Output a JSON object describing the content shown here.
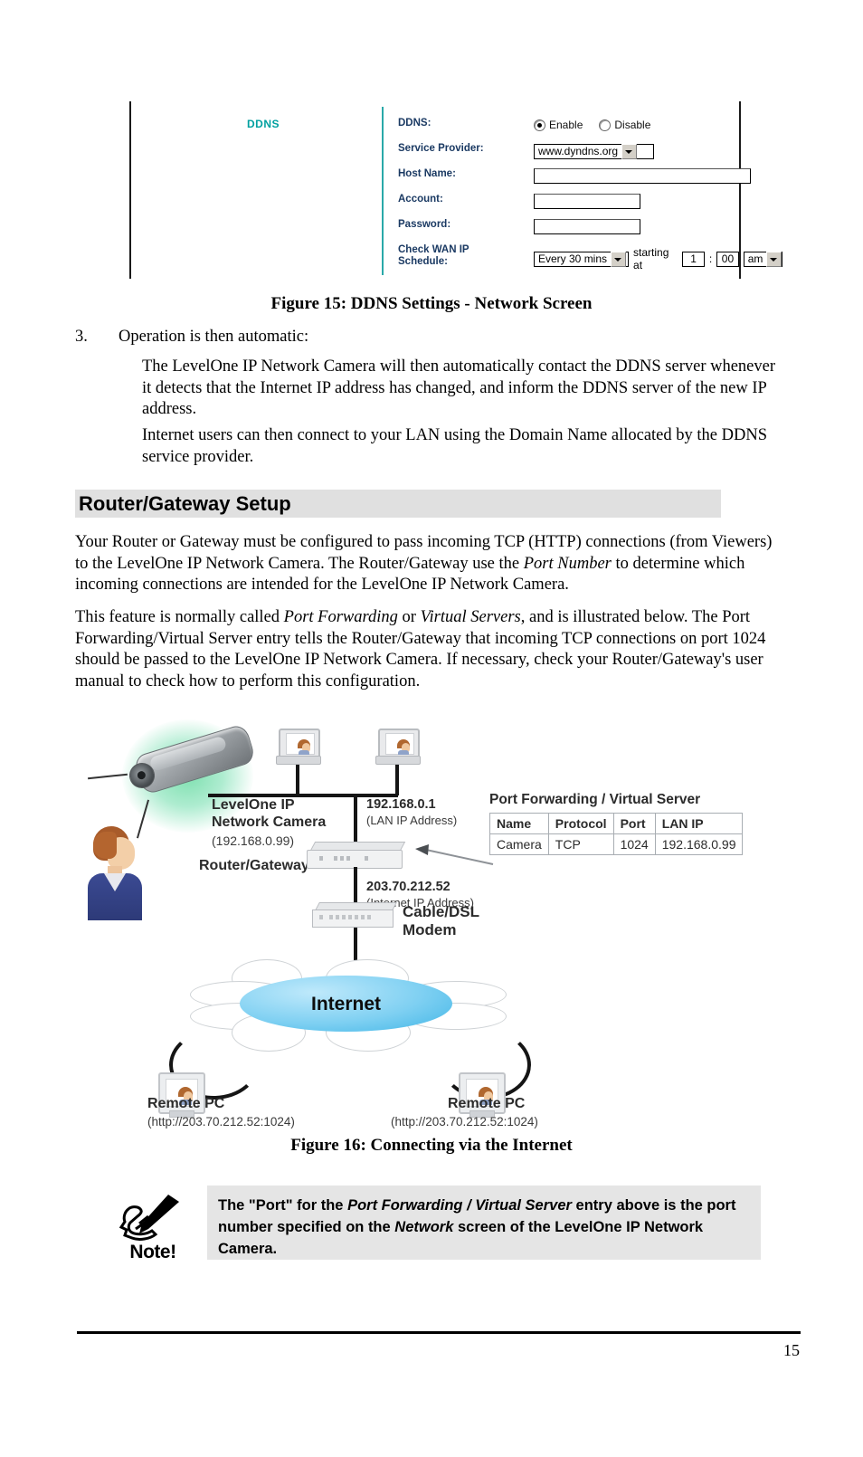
{
  "figure15": {
    "section_label": "DDNS",
    "rows": [
      {
        "label": "DDNS:",
        "type": "radio",
        "options": [
          {
            "label": "Enable",
            "selected": true
          },
          {
            "label": "Disable",
            "selected": false
          }
        ]
      },
      {
        "label": "Service Provider:",
        "type": "select",
        "value": "www.dyndns.org"
      },
      {
        "label": "Host Name:",
        "type": "text",
        "value": ""
      },
      {
        "label": "Account:",
        "type": "text",
        "value": ""
      },
      {
        "label": "Password:",
        "type": "text",
        "value": ""
      },
      {
        "label": "Check WAN IP\nSchedule:",
        "type": "schedule",
        "interval": "Every 30 mins",
        "starting_text": "starting at",
        "hour": "1",
        "colon": ":",
        "minute": "00",
        "ampm": "am"
      }
    ],
    "caption": "Figure 15: DDNS Settings - Network Screen"
  },
  "step3": {
    "number": "3.",
    "title": "Operation is then automatic:",
    "para1": "The LevelOne IP Network Camera will then automatically contact the DDNS server whenever it detects that the Internet IP address has changed, and inform the DDNS server of the new IP address.",
    "para2": "Internet users can then connect to your LAN using the Domain Name allocated by the DDNS service provider."
  },
  "section": {
    "heading": "Router/Gateway Setup",
    "para1_a": "Your Router or Gateway must be configured to pass incoming TCP (HTTP) connections (from Viewers) to the LevelOne IP Network Camera. The Router/Gateway use the ",
    "para1_em": "Port Number",
    "para1_b": " to determine which incoming connections are intended for the LevelOne IP Network Camera.",
    "para2_a": "This feature is normally called ",
    "para2_em1": "Port Forwarding",
    "para2_b": " or ",
    "para2_em2": "Virtual Servers",
    "para2_c": ", and is illustrated below. The Port Forwarding/Virtual Server entry tells the Router/Gateway that incoming TCP connections on port 1024 should be passed to the LevelOne IP Network Camera. If necessary, check your Router/Gateway's user manual to check how to perform this configuration."
  },
  "figure16": {
    "camera_label": "LevelOne IP\nNetwork Camera",
    "camera_ip": "(192.168.0.99)",
    "router_label": "Router/Gateway",
    "lan_ip": "192.168.0.1",
    "lan_ip_sub": "(LAN IP Address)",
    "internet_ip": "203.70.212.52",
    "internet_ip_sub": "(Internet IP Address)",
    "modem_label": "Cable/DSL\nModem",
    "cloud_label": "Internet",
    "remote_pc_left": "Remote PC",
    "remote_pc_left_url": "(http://203.70.212.52:1024)",
    "remote_pc_right": "Remote PC",
    "remote_pc_right_url": "(http://203.70.212.52:1024)",
    "pf_title": "Port Forwarding / Virtual Server",
    "pf_headers": [
      "Name",
      "Protocol",
      "Port",
      "LAN IP"
    ],
    "pf_row": [
      "Camera",
      "TCP",
      "1024",
      "192.168.0.99"
    ],
    "caption": "Figure 16: Connecting via the Internet"
  },
  "note": {
    "icon_label": "Note!",
    "text_a": "The \"Port\" for the ",
    "text_em1": "Port Forwarding / Virtual Server",
    "text_b": " entry above is the port number specified on the ",
    "text_em2": "Network",
    "text_c": " screen of the LevelOne IP Network Camera."
  },
  "footer": {
    "page_number": "15"
  },
  "colors": {
    "section_label": "#00a0a0",
    "form_label": "#1b3a63",
    "heading_band": "#e0e0e0",
    "note_band": "#e5e5e5",
    "cloud": "#3fb5e6"
  }
}
